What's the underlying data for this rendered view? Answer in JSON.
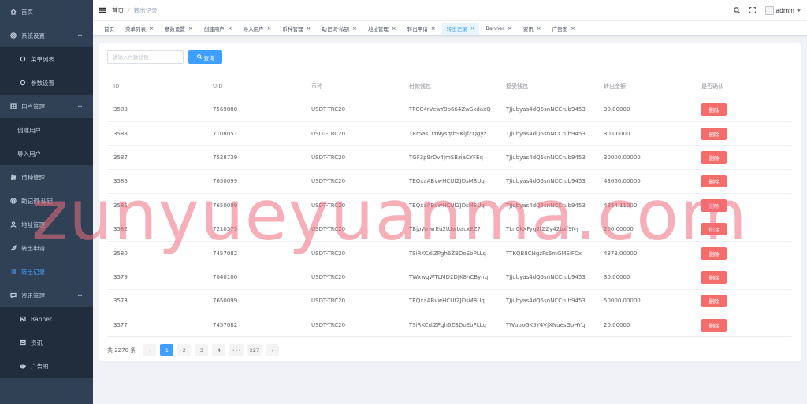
{
  "sidebar": {
    "items": [
      {
        "label": "首页",
        "icon": "home-icon",
        "sub": false,
        "arrow": false,
        "active": false
      },
      {
        "label": "系统设置",
        "icon": "gear-icon",
        "sub": false,
        "arrow": true,
        "active": false
      },
      {
        "label": "菜单列表",
        "icon": "circle-icon",
        "sub": true,
        "arrow": false,
        "active": false
      },
      {
        "label": "参数设置",
        "icon": "circle-icon",
        "sub": true,
        "arrow": false,
        "active": false
      },
      {
        "label": "用户管理",
        "icon": "grid-icon",
        "sub": false,
        "arrow": true,
        "active": false
      },
      {
        "label": "创建用户",
        "icon": "",
        "sub": true,
        "arrow": false,
        "active": false
      },
      {
        "label": "导入用户",
        "icon": "",
        "sub": true,
        "arrow": false,
        "active": false
      },
      {
        "label": "币种管理",
        "icon": "sliders-icon",
        "sub": false,
        "arrow": false,
        "active": false
      },
      {
        "label": "助记词·私钥",
        "icon": "gear-icon",
        "sub": false,
        "arrow": false,
        "active": false
      },
      {
        "label": "地址管理",
        "icon": "user-icon",
        "sub": false,
        "arrow": false,
        "active": false
      },
      {
        "label": "转出申请",
        "icon": "rocket-icon",
        "sub": false,
        "arrow": false,
        "active": false
      },
      {
        "label": "转出记录",
        "icon": "list-icon",
        "sub": false,
        "arrow": false,
        "active": true
      },
      {
        "label": "资讯管理",
        "icon": "chat-icon",
        "sub": false,
        "arrow": true,
        "active": false
      },
      {
        "label": "Banner",
        "icon": "image-icon",
        "sub": true,
        "arrow": false,
        "active": false
      },
      {
        "label": "资讯",
        "icon": "message-icon",
        "sub": true,
        "arrow": false,
        "active": false
      },
      {
        "label": "广告图",
        "icon": "eye-icon",
        "sub": true,
        "arrow": false,
        "active": false
      }
    ]
  },
  "breadcrumb": {
    "home": "首页",
    "separator": "/",
    "current": "转出记录"
  },
  "header": {
    "user": "admin"
  },
  "tags": [
    {
      "label": "首页",
      "closable": false,
      "active": false
    },
    {
      "label": "菜单列表",
      "closable": true,
      "active": false
    },
    {
      "label": "参数设置",
      "closable": true,
      "active": false
    },
    {
      "label": "创建用户",
      "closable": true,
      "active": false
    },
    {
      "label": "导入用户",
      "closable": true,
      "active": false
    },
    {
      "label": "币种管理",
      "closable": true,
      "active": false
    },
    {
      "label": "助记词·私钥",
      "closable": true,
      "active": false
    },
    {
      "label": "地址管理",
      "closable": true,
      "active": false
    },
    {
      "label": "转出申请",
      "closable": true,
      "active": false
    },
    {
      "label": "转出记录",
      "closable": true,
      "active": true
    },
    {
      "label": "Banner",
      "closable": true,
      "active": false
    },
    {
      "label": "资讯",
      "closable": true,
      "active": false
    },
    {
      "label": "广告图",
      "closable": true,
      "active": false
    }
  ],
  "search": {
    "placeholder": "请输入付款钱包",
    "button_label": "查询",
    "value": ""
  },
  "table": {
    "columns": [
      "ID",
      "UID",
      "币种",
      "付款钱包",
      "接受钱包",
      "转出金额",
      "是否确认"
    ],
    "action_label": "删除",
    "rows": [
      [
        "3589",
        "7569888",
        "USDT-TRC20",
        "TPCC4rVcwY9o664ZwSkdaxQ",
        "TJjubyas4dQ5snNCCrub9453",
        "30.00000"
      ],
      [
        "3588",
        "7108051",
        "USDT-TRC20",
        "TRr5asTfYNysqtb9KiJfZQgyz",
        "TJjubyas4dQ5snNCCrub9453",
        "30.00000"
      ],
      [
        "3587",
        "7528739",
        "USDT-TRC20",
        "TGF3p9rDv4JmSBziaCYFEq",
        "TJjubyas4dQ5snNCCrub9453",
        "30000.00000"
      ],
      [
        "3586",
        "7650099",
        "USDT-TRC20",
        "TEQxaABvwHCUfZJDsM8Uq",
        "TJjubyas4dQ5snNCCrub9453",
        "43660.00000"
      ],
      [
        "3585",
        "7650099",
        "USDT-TRC20",
        "TEQxaABvwHCUfZJDsM8Uq",
        "TJjubyas4dQ5snNCCrub9453",
        "4854.11000"
      ],
      [
        "3582",
        "7210575",
        "USDT-TRC20",
        "TBjpWrwrEu2tUwbacxEZ7",
        "TLnCkXFyg2tZZy42bxf9Ny",
        "200.00000"
      ],
      [
        "3580",
        "7457082",
        "USDT-TRC20",
        "TSiRKCdiZPgh6ZBDoEbPLLq",
        "TTKQB8CHgzPs6mGMSiFCx",
        "4373.00000"
      ],
      [
        "3579",
        "7040100",
        "USDT-TRC20",
        "TWxwgWTLMD2DJK8hCByhq",
        "TJjubyas4dQ5snNCCrub9453",
        "30.00000"
      ],
      [
        "3578",
        "7650099",
        "USDT-TRC20",
        "TEQxaABvwHCUfZJDsM8Uq",
        "TJjubyas4dQ5snNCCrub9453",
        "50000.00000"
      ],
      [
        "3577",
        "7457082",
        "USDT-TRC20",
        "TSiRKCdiZPgh6ZBDoEbPLLq",
        "TWuboGK5Y4VjXNuesGpHYq",
        "20.00000"
      ]
    ]
  },
  "pagination": {
    "total_label": "共 2270 条",
    "prev": "‹",
    "next": "›",
    "pages": [
      "1",
      "2",
      "3",
      "4",
      "•••",
      "227"
    ],
    "current": "1"
  },
  "watermark": "zunyueyuanma.com",
  "colors": {
    "primary": "#409eff",
    "danger": "#f56c6c",
    "sidebar": "#304156"
  }
}
